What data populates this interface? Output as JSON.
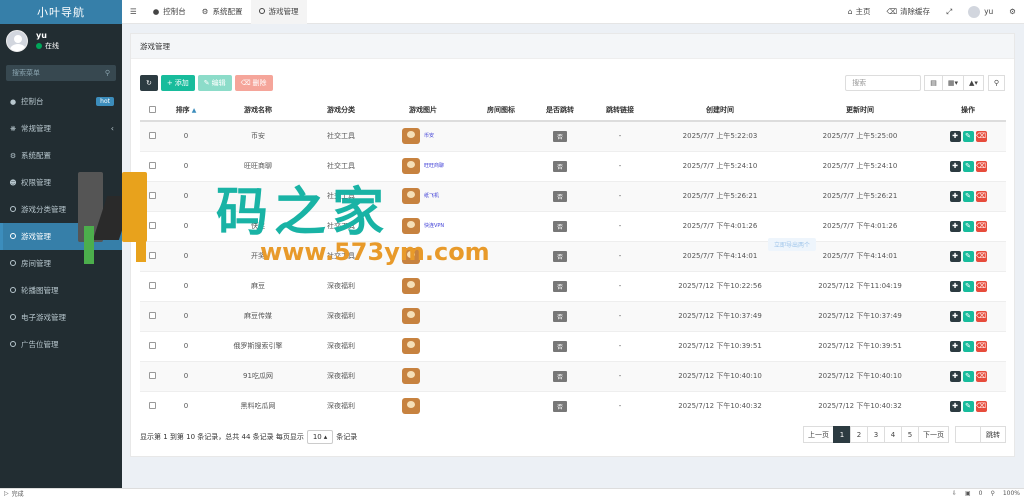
{
  "app": {
    "title": "小叶导航"
  },
  "user": {
    "name": "yu",
    "status": "在线"
  },
  "sidebar": {
    "search_placeholder": "搜索菜单",
    "items": [
      {
        "label": "控制台",
        "badge": "hot",
        "icon": "dashboard-icon"
      },
      {
        "label": "常规管理",
        "icon": "cogs-icon",
        "arrow": "‹"
      },
      {
        "label": "系统配置",
        "icon": "cog-icon"
      },
      {
        "label": "权限管理",
        "icon": "group-icon"
      },
      {
        "label": "游戏分类管理",
        "icon": "circle-icon"
      },
      {
        "label": "游戏管理",
        "icon": "circle-icon",
        "active": true
      },
      {
        "label": "房间管理",
        "icon": "circle-icon"
      },
      {
        "label": "轮播图管理",
        "icon": "circle-icon"
      },
      {
        "label": "电子游戏管理",
        "icon": "circle-icon"
      },
      {
        "label": "广告位管理",
        "icon": "circle-icon"
      }
    ]
  },
  "topbar": {
    "tabs": [
      {
        "label": "控制台",
        "icon": "dashboard-icon"
      },
      {
        "label": "系统配置",
        "icon": "cog-icon"
      },
      {
        "label": "游戏管理",
        "icon": "circle-icon",
        "active": true
      }
    ],
    "home": "主页",
    "clear_cache": "清除缓存",
    "user": "yu"
  },
  "page": {
    "title": "游戏管理"
  },
  "toolbar": {
    "add": "添加",
    "edit": "编辑",
    "delete": "删除",
    "search_placeholder": "搜索"
  },
  "table": {
    "headers": [
      "排序",
      "游戏名称",
      "游戏分类",
      "游戏图片",
      "房间图标",
      "是否跳转",
      "跳转链接",
      "创建时间",
      "更新时间",
      "操作"
    ],
    "rows": [
      {
        "sort": "0",
        "name": "币安",
        "category": "社交工具",
        "img_caption": "币安",
        "jump": "否",
        "link": "-",
        "created": "2025/7/7 上午5:22:03",
        "updated": "2025/7/7 上午5:25:00"
      },
      {
        "sort": "0",
        "name": "旺旺商聊",
        "category": "社交工具",
        "img_caption": "旺旺商聊",
        "jump": "否",
        "link": "-",
        "created": "2025/7/7 上午5:24:10",
        "updated": "2025/7/7 上午5:24:10"
      },
      {
        "sort": "0",
        "name": "",
        "category": "社交工具",
        "img_caption": "纸飞机",
        "jump": "否",
        "link": "-",
        "created": "2025/7/7 上午5:26:21",
        "updated": "2025/7/7 上午5:26:21"
      },
      {
        "sort": "0",
        "name": "快连",
        "category": "社交工具",
        "img_caption": "快连VPN",
        "jump": "否",
        "link": "-",
        "created": "2025/7/7 下午4:01:26",
        "updated": "2025/7/7 下午4:01:26"
      },
      {
        "sort": "0",
        "name": "开奖",
        "category": "社交工具",
        "img_caption": "",
        "jump": "否",
        "link": "-",
        "created": "2025/7/7 下午4:14:01",
        "updated": "2025/7/7 下午4:14:01"
      },
      {
        "sort": "0",
        "name": "麻豆",
        "category": "深夜福利",
        "img_caption": "",
        "jump": "否",
        "link": "-",
        "created": "2025/7/12 下午10:22:56",
        "updated": "2025/7/12 下午11:04:19"
      },
      {
        "sort": "0",
        "name": "麻豆传媒",
        "category": "深夜福利",
        "img_caption": "",
        "jump": "否",
        "link": "-",
        "created": "2025/7/12 下午10:37:49",
        "updated": "2025/7/12 下午10:37:49"
      },
      {
        "sort": "0",
        "name": "俄罗斯搜索引擎",
        "category": "深夜福利",
        "img_caption": "",
        "jump": "否",
        "link": "-",
        "created": "2025/7/12 下午10:39:51",
        "updated": "2025/7/12 下午10:39:51"
      },
      {
        "sort": "0",
        "name": "91吃瓜网",
        "category": "深夜福利",
        "img_caption": "",
        "jump": "否",
        "link": "-",
        "created": "2025/7/12 下午10:40:10",
        "updated": "2025/7/12 下午10:40:10"
      },
      {
        "sort": "0",
        "name": "黑料吃瓜网",
        "category": "深夜福利",
        "img_caption": "",
        "jump": "否",
        "link": "-",
        "created": "2025/7/12 下午10:40:32",
        "updated": "2025/7/12 下午10:40:32"
      }
    ]
  },
  "pagination": {
    "info_prefix": "显示第 1 到第 10 条记录，总共 44 条记录 每页显示",
    "page_size": "10",
    "info_suffix": "条记录",
    "prev": "上一页",
    "pages": [
      "1",
      "2",
      "3",
      "4",
      "5"
    ],
    "current": "1",
    "next": "下一页",
    "go": "跳转"
  },
  "watermark": {
    "text": "码之家",
    "url": "www.573ym.com"
  },
  "ghost_tip": "立即导出两个",
  "statusbar": {
    "left": "完成",
    "zoom": "100%",
    "count": "0"
  },
  "colors": {
    "sidebar": "#222d32",
    "logo": "#367fa9",
    "accent": "#18bc9c",
    "danger": "#e74c3c",
    "dark": "#2c3b41"
  }
}
